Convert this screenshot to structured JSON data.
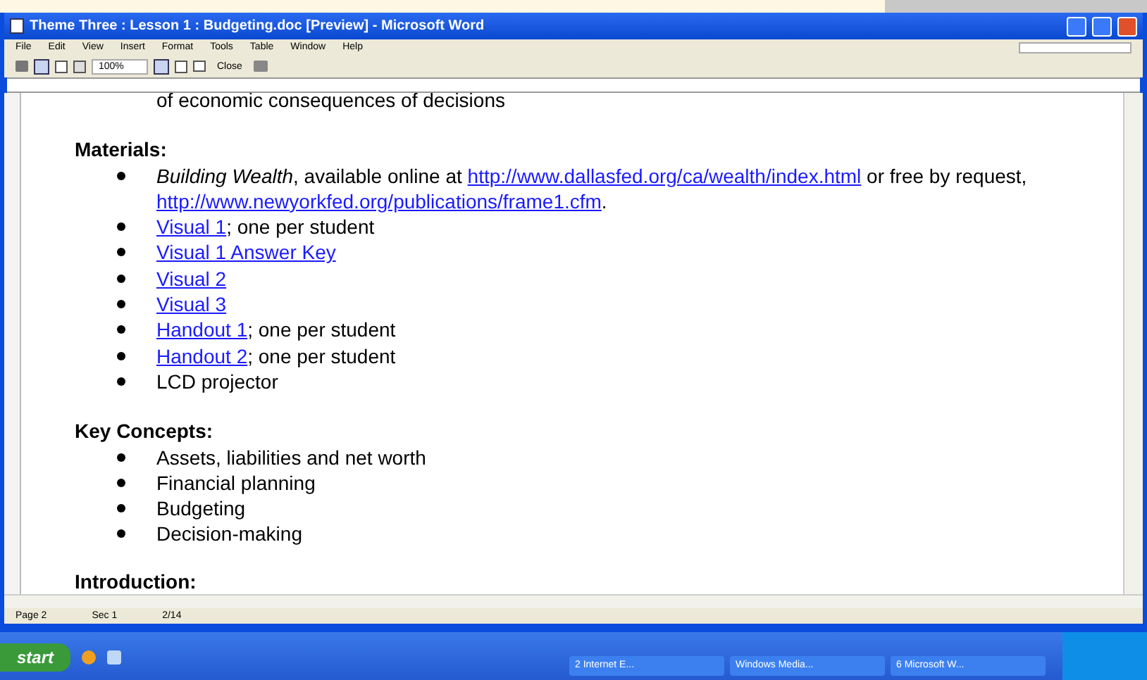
{
  "window": {
    "title": "Theme Three : Lesson 1 : Budgeting.doc [Preview] - Microsoft Word"
  },
  "menu": [
    "File",
    "Edit",
    "View",
    "Insert",
    "Format",
    "Tools",
    "Table",
    "Window",
    "Help"
  ],
  "toolbar": {
    "zoom": "100%",
    "close": "Close"
  },
  "document": {
    "cut_line": "of economic consequences of decisions",
    "sections": [
      {
        "heading": "Materials:",
        "items": [
          [
            {
              "kind": "italic",
              "text": "Building Wealth"
            },
            {
              "kind": "plain",
              "text": ", available online at "
            },
            {
              "kind": "link",
              "text": "http://www.dallasfed.org/ca/wealth/index.html"
            },
            {
              "kind": "plain",
              "text": " or free by request, "
            },
            {
              "kind": "link",
              "text": "http://www.newyorkfed.org/publications/frame1.cfm"
            },
            {
              "kind": "plain",
              "text": "."
            }
          ],
          [
            {
              "kind": "link",
              "text": "Visual 1"
            },
            {
              "kind": "plain",
              "text": "; one per student"
            }
          ],
          [
            {
              "kind": "link",
              "text": "Visual 1 Answer Key"
            }
          ],
          [
            {
              "kind": "link",
              "text": "Visual 2"
            }
          ],
          [
            {
              "kind": "link",
              "text": "Visual 3"
            }
          ],
          [
            {
              "kind": "link",
              "text": "Handout 1"
            },
            {
              "kind": "plain",
              "text": "; one per student"
            }
          ],
          [
            {
              "kind": "link",
              "text": "Handout 2"
            },
            {
              "kind": "plain",
              "text": "; one per student"
            }
          ],
          [
            {
              "kind": "plain",
              "text": "LCD projector"
            }
          ]
        ]
      },
      {
        "heading": "Key Concepts:",
        "items": [
          [
            {
              "kind": "plain",
              "text": "Assets, liabilities and net worth"
            }
          ],
          [
            {
              "kind": "plain",
              "text": "Financial planning"
            }
          ],
          [
            {
              "kind": "plain",
              "text": "Budgeting"
            }
          ],
          [
            {
              "kind": "plain",
              "text": "Decision-making"
            }
          ]
        ]
      }
    ],
    "next_heading": "Introduction:"
  },
  "status_bar": [
    "Page 2",
    "Sec 1",
    "2/14"
  ],
  "taskbar": {
    "start": "start",
    "tasks": [
      "2 Internet E...",
      "Windows Media...",
      "6 Microsoft W..."
    ]
  }
}
